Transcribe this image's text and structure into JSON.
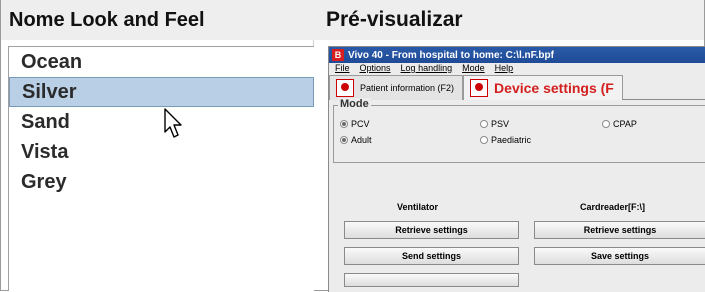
{
  "header": {
    "left_title": "Nome Look and Feel",
    "right_title": "Pré-visualizar"
  },
  "lookandfeel": {
    "items": [
      {
        "label": "Ocean"
      },
      {
        "label": "Silver"
      },
      {
        "label": "Sand"
      },
      {
        "label": "Vista"
      },
      {
        "label": "Grey"
      }
    ],
    "selected_index": 1
  },
  "preview": {
    "window_title": "Vivo 40 - From hospital to home: C:\\l.nF.bpf",
    "app_icon_glyph": "B",
    "menu": [
      "File",
      "Options",
      "Log handling",
      "Mode",
      "Help"
    ],
    "tabs": [
      {
        "label": "Patient information (F2)"
      },
      {
        "label": "Device settings (F"
      }
    ],
    "mode": {
      "title": "Mode",
      "options_row1": [
        {
          "label": "PCV",
          "selected": true
        },
        {
          "label": "PSV",
          "selected": false
        },
        {
          "label": "CPAP",
          "selected": false
        }
      ],
      "options_row2": [
        {
          "label": "Adult",
          "selected": true
        },
        {
          "label": "Paediatric",
          "selected": false
        }
      ]
    },
    "ventilator": {
      "label": "Ventilator",
      "buttons": [
        "Retrieve settings",
        "Send settings"
      ]
    },
    "cardreader": {
      "label": "Cardreader[F:\\]",
      "buttons": [
        "Retrieve settings",
        "Save settings"
      ]
    }
  }
}
